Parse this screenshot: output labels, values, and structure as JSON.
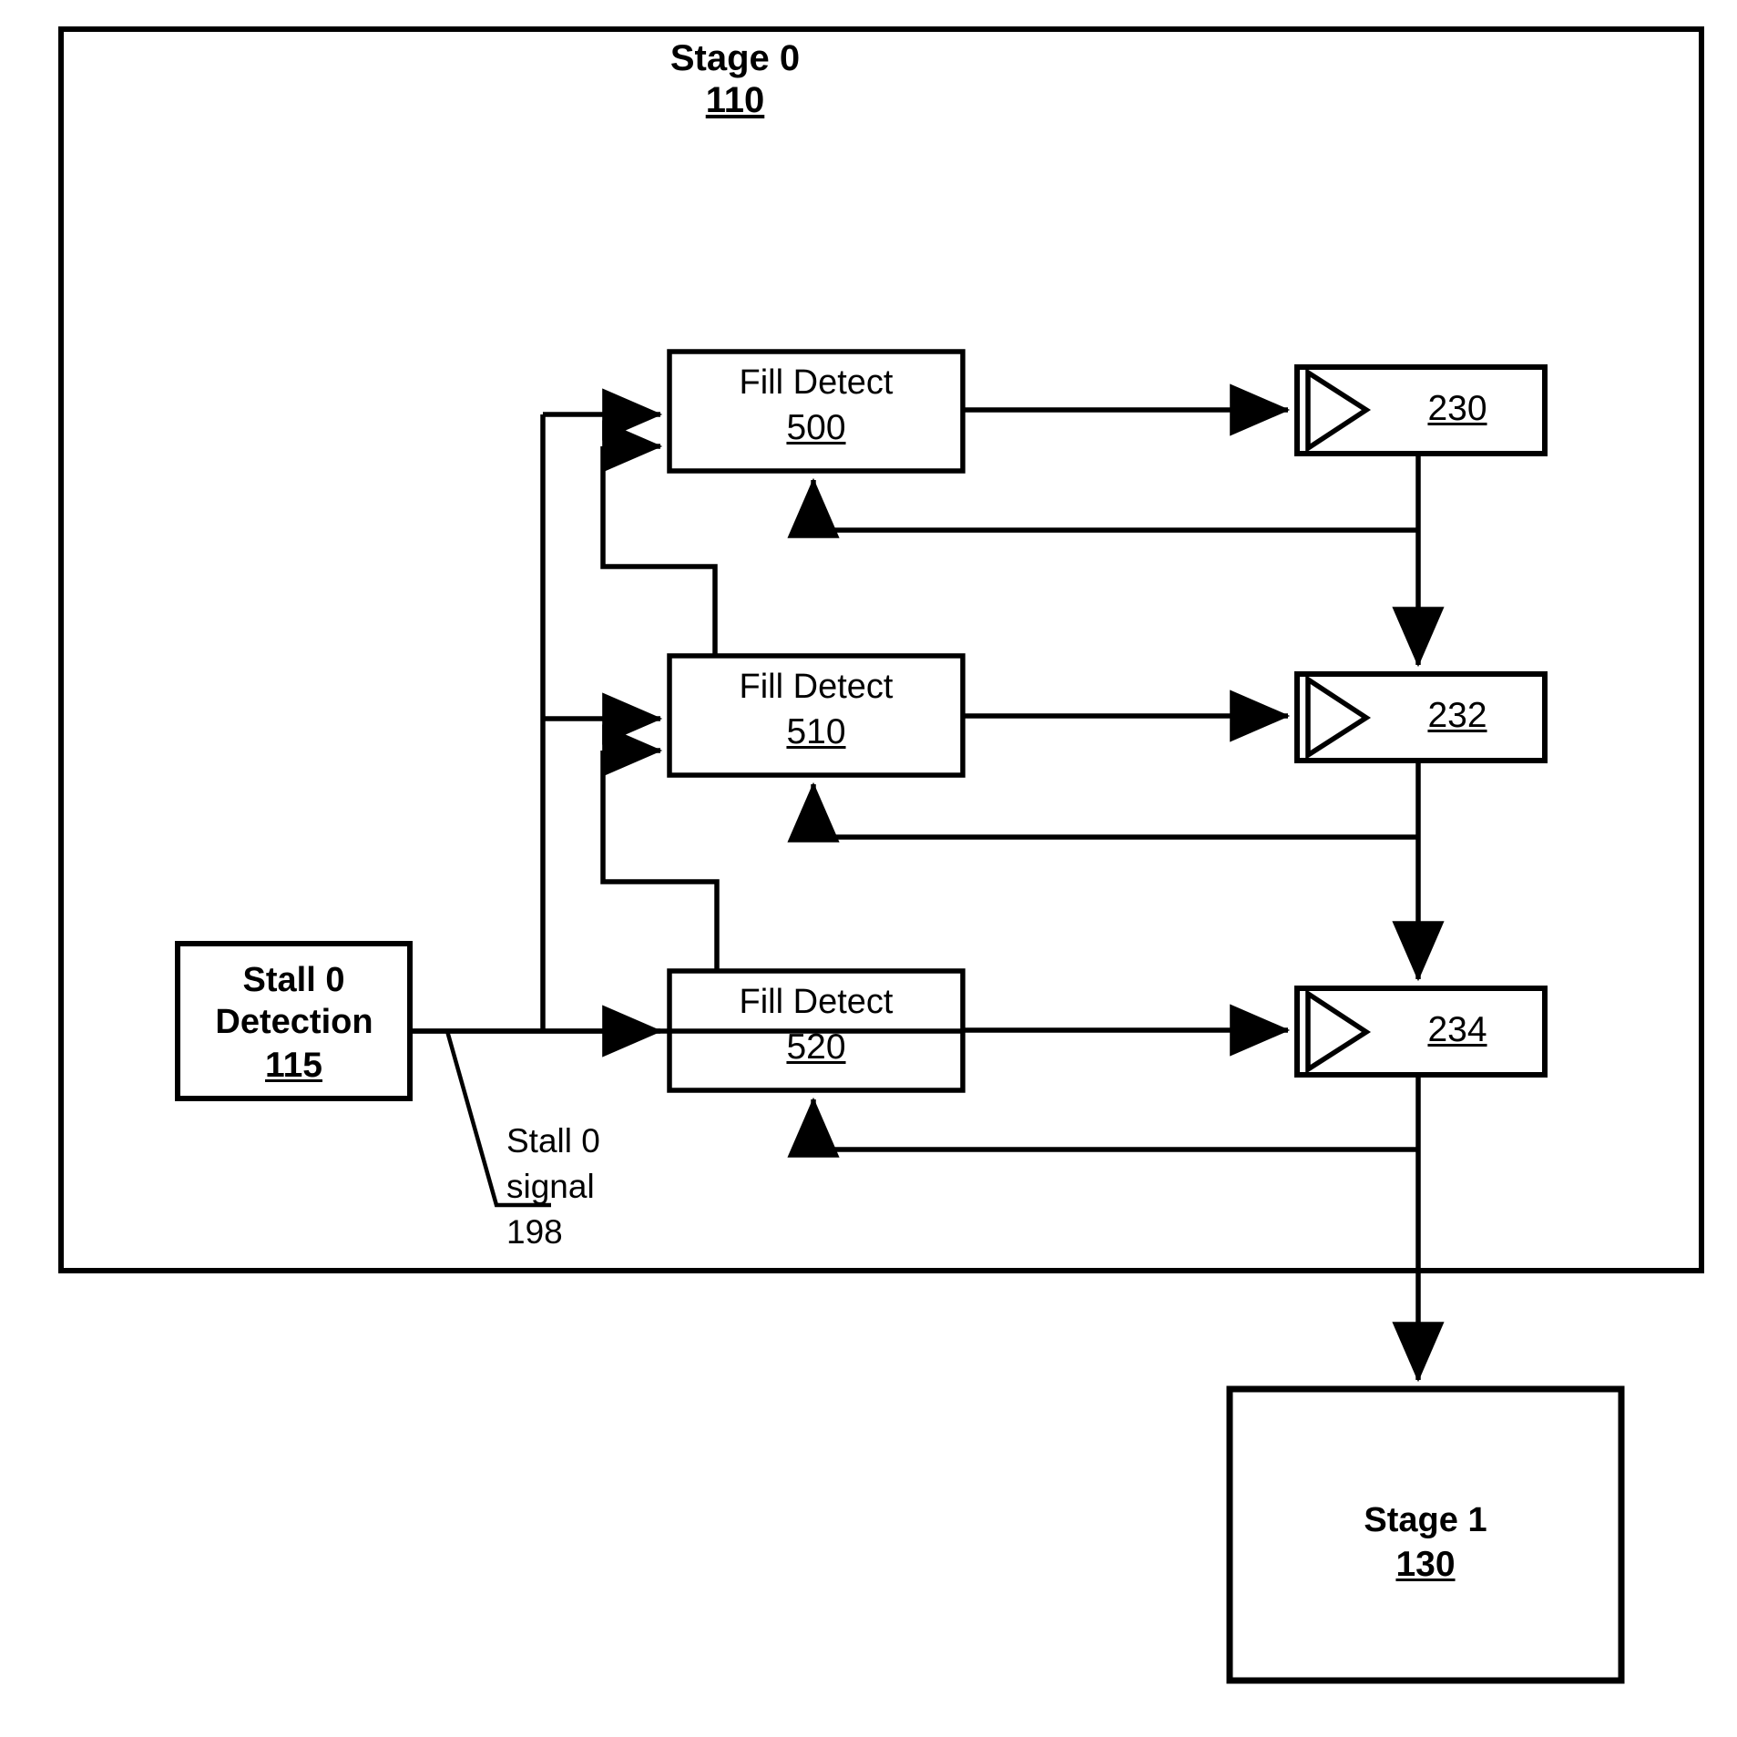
{
  "diagram": {
    "type": "block-diagram",
    "title": "Stage 0",
    "outer_stage": {
      "label": "Stage 0",
      "ref": "110"
    },
    "blocks": [
      {
        "id": "fill-detect-500",
        "label": "Fill Detect",
        "ref": "500"
      },
      {
        "id": "fill-detect-510",
        "label": "Fill Detect",
        "ref": "510"
      },
      {
        "id": "fill-detect-520",
        "label": "Fill Detect",
        "ref": "520"
      }
    ],
    "latches": [
      {
        "id": "latch-230",
        "ref": "230",
        "icon": "buffer-triangle-icon"
      },
      {
        "id": "latch-232",
        "ref": "232",
        "icon": "buffer-triangle-icon"
      },
      {
        "id": "latch-234",
        "ref": "234",
        "icon": "buffer-triangle-icon"
      }
    ],
    "stall_detection": {
      "line1": "Stall 0",
      "line2": "Detection",
      "ref": "115"
    },
    "signal_callout": {
      "line1": "Stall 0",
      "line2": "signal",
      "ref": "198"
    },
    "next_stage": {
      "label": "Stage 1",
      "ref": "130"
    },
    "colors": {
      "stroke": "#000000",
      "fill": "#ffffff",
      "text": "#000000"
    }
  }
}
